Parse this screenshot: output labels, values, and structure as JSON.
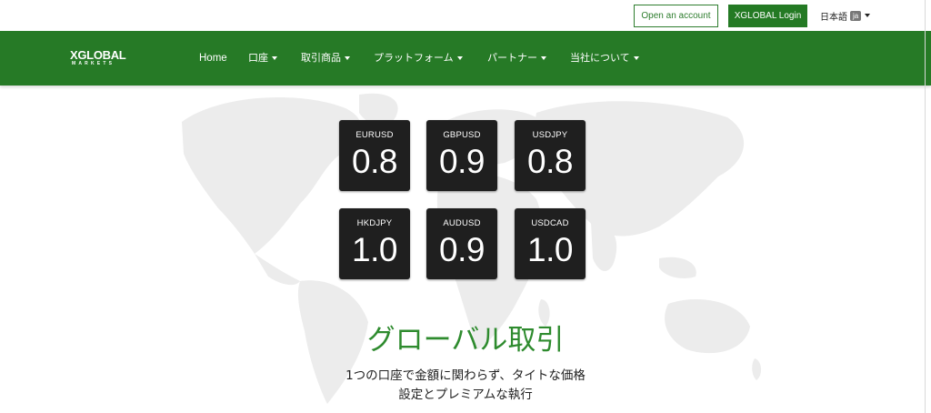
{
  "header": {
    "open_account_label": "Open an account",
    "login_label": "XGLOBAL Login",
    "language_label": "日本語",
    "language_badge": "ja"
  },
  "nav": {
    "logo_main": "XGLOBAL",
    "logo_sub": "MARKETS",
    "items": [
      {
        "label": "Home",
        "has_dropdown": false
      },
      {
        "label": "口座",
        "has_dropdown": true
      },
      {
        "label": "取引商品",
        "has_dropdown": true
      },
      {
        "label": "プラットフォーム",
        "has_dropdown": true
      },
      {
        "label": "パートナー",
        "has_dropdown": true
      },
      {
        "label": "当社について",
        "has_dropdown": true
      }
    ]
  },
  "spreads": [
    {
      "pair": "EURUSD",
      "value": "0.8"
    },
    {
      "pair": "GBPUSD",
      "value": "0.9"
    },
    {
      "pair": "USDJPY",
      "value": "0.8"
    },
    {
      "pair": "HKDJPY",
      "value": "1.0"
    },
    {
      "pair": "AUDUSD",
      "value": "0.9"
    },
    {
      "pair": "USDCAD",
      "value": "1.0"
    }
  ],
  "hero": {
    "headline": "グローバル取引",
    "subline1": "1つの口座で金額に関わらず、タイトな価格",
    "subline2": "設定とプレミアムな執行"
  },
  "colors": {
    "brand_green": "#267a26",
    "headline_green": "#2e8b2e",
    "tile_bg": "#1f1f1f",
    "map_gray": "#ececec"
  },
  "icons": [
    "caret-down-icon",
    "world-map-graphic"
  ]
}
